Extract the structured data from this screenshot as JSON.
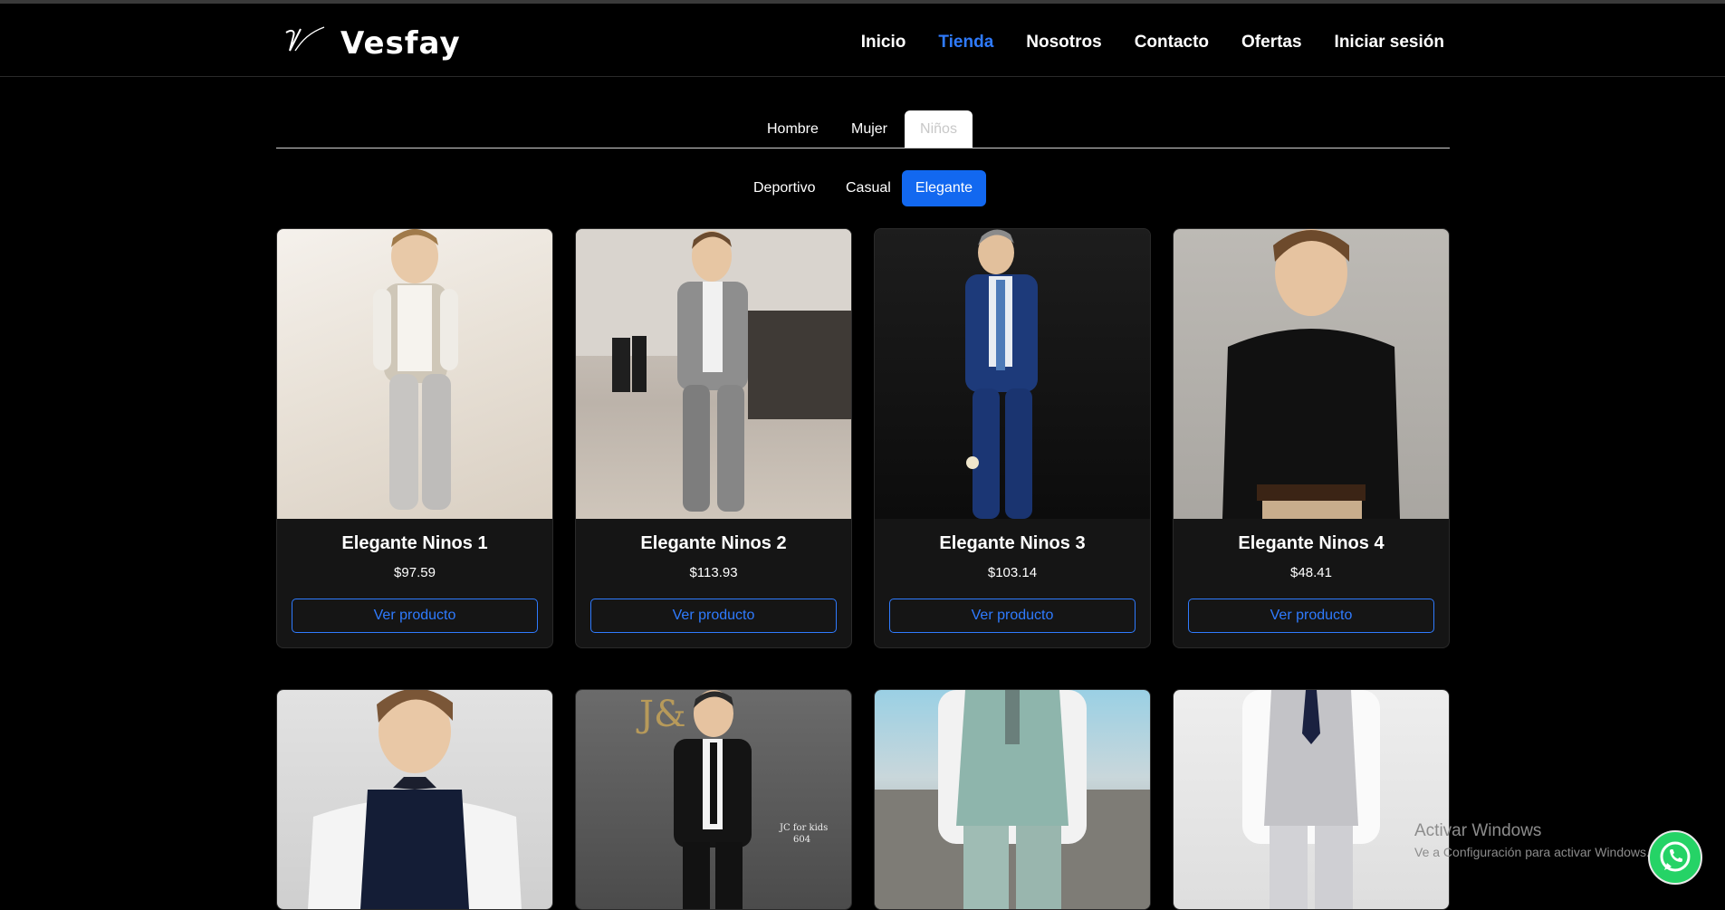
{
  "brand": {
    "name": "Vesfay",
    "logo": "vesfay-logo"
  },
  "nav": {
    "items": [
      {
        "label": "Inicio",
        "active": false
      },
      {
        "label": "Tienda",
        "active": true
      },
      {
        "label": "Nosotros",
        "active": false
      },
      {
        "label": "Contacto",
        "active": false
      },
      {
        "label": "Ofertas",
        "active": false
      },
      {
        "label": "Iniciar sesión",
        "active": false
      }
    ],
    "active_color": "#2f7bff"
  },
  "categories": {
    "tabs": [
      {
        "label": "Hombre",
        "selected": false
      },
      {
        "label": "Mujer",
        "selected": false
      },
      {
        "label": "Niños",
        "selected": true
      }
    ]
  },
  "styles": {
    "filters": [
      {
        "label": "Deportivo",
        "selected": false
      },
      {
        "label": "Casual",
        "selected": false
      },
      {
        "label": "Elegante",
        "selected": true
      }
    ],
    "accent": "#1268f0"
  },
  "products": [
    {
      "name": "Elegante Ninos 1",
      "price": "$97.59",
      "button": "Ver producto"
    },
    {
      "name": "Elegante Ninos 2",
      "price": "$113.93",
      "button": "Ver producto"
    },
    {
      "name": "Elegante Ninos 3",
      "price": "$103.14",
      "button": "Ver producto"
    },
    {
      "name": "Elegante Ninos 4",
      "price": "$48.41",
      "button": "Ver producto"
    },
    {
      "name": "",
      "price": "",
      "button": ""
    },
    {
      "name": "",
      "price": "",
      "button": ""
    },
    {
      "name": "",
      "price": "",
      "button": ""
    },
    {
      "name": "",
      "price": "",
      "button": ""
    }
  ],
  "product_images": {
    "card6_overlay": "JC for kids",
    "card6_overlay_line2": "604"
  },
  "watermark": {
    "line1": "Activar Windows",
    "line2": "Ve a Configuración para activar Windows."
  },
  "whatsapp": {
    "icon": "whatsapp-icon",
    "color": "#25d366"
  }
}
